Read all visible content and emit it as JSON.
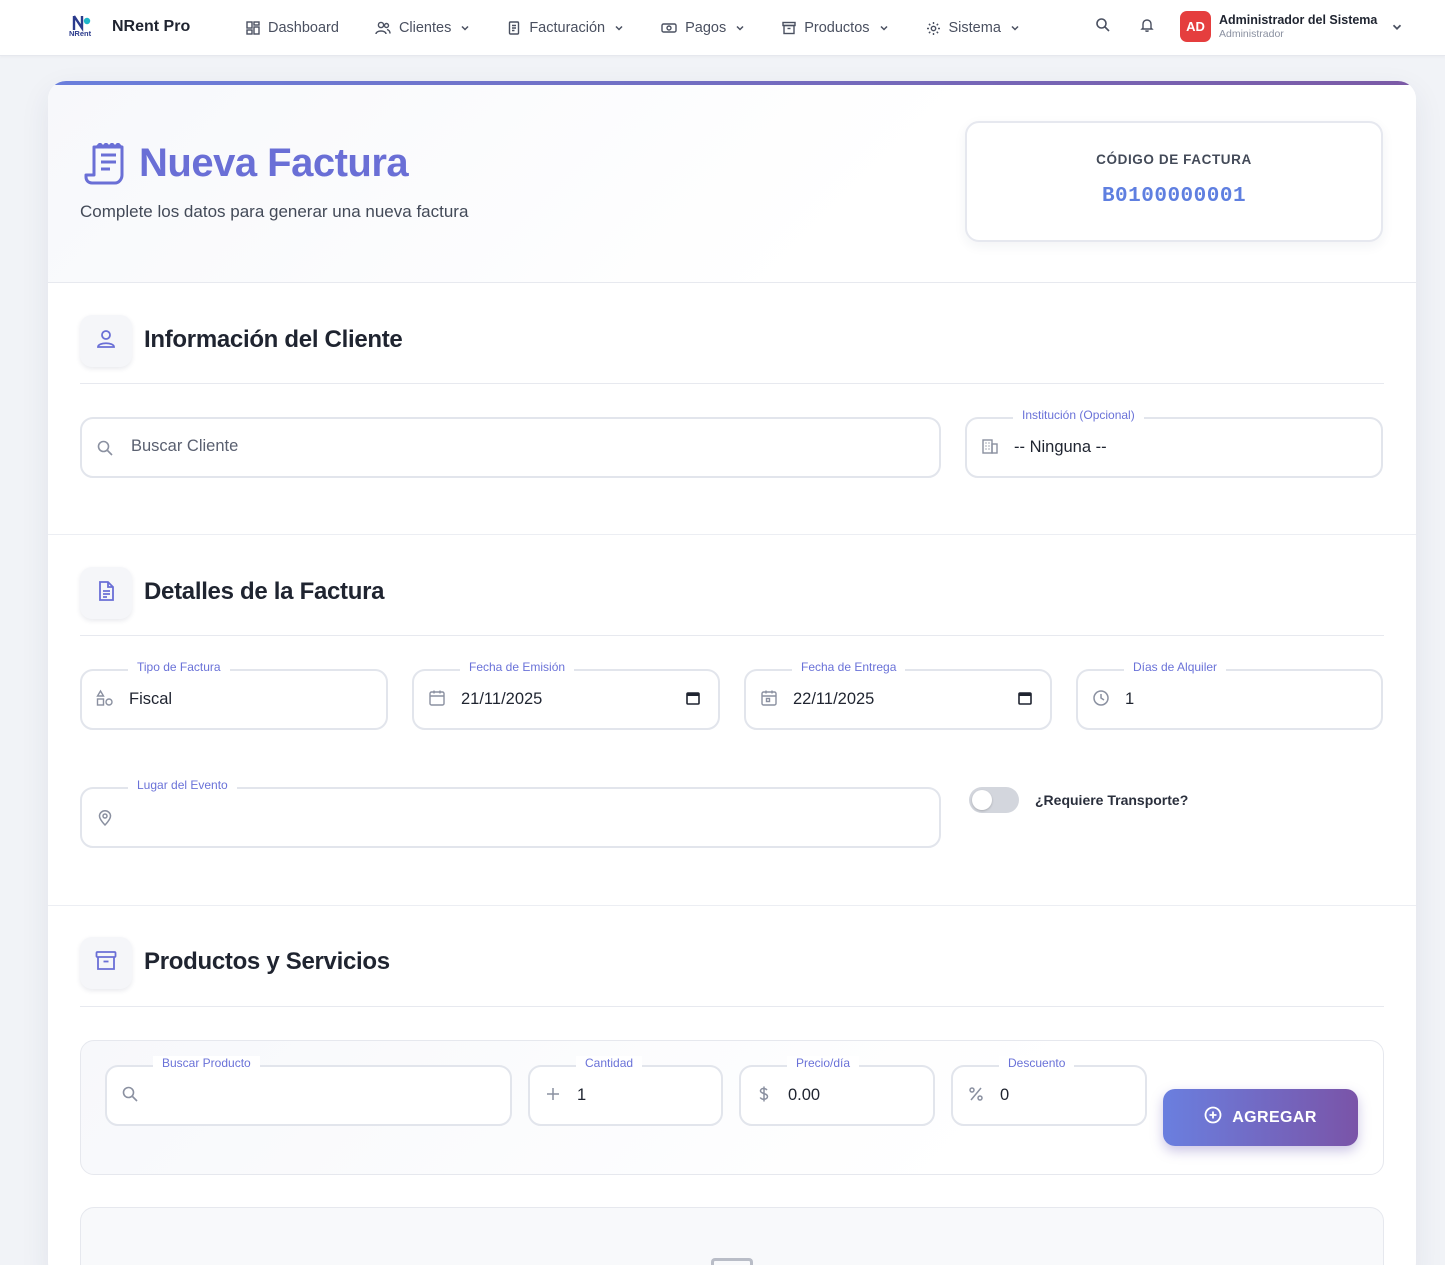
{
  "app": {
    "brand": "NRent Pro",
    "logo_text": "NRent"
  },
  "nav": {
    "items": [
      {
        "label": "Dashboard",
        "icon": "dashboard-icon",
        "has_menu": false
      },
      {
        "label": "Clientes",
        "icon": "users-icon",
        "has_menu": true
      },
      {
        "label": "Facturación",
        "icon": "receipt-icon",
        "has_menu": true
      },
      {
        "label": "Pagos",
        "icon": "money-icon",
        "has_menu": true
      },
      {
        "label": "Productos",
        "icon": "archive-icon",
        "has_menu": true
      },
      {
        "label": "Sistema",
        "icon": "gear-icon",
        "has_menu": true
      }
    ]
  },
  "user": {
    "initials": "AD",
    "name": "Administrador del Sistema",
    "role": "Administrador"
  },
  "page": {
    "title": "Nueva Factura",
    "subtitle": "Complete los datos para generar una nueva factura",
    "code_label": "CÓDIGO DE FACTURA",
    "code_value": "B0100000001"
  },
  "client_section": {
    "title": "Información del Cliente",
    "search_placeholder": "Buscar Cliente",
    "institution_label": "Institución (Opcional)",
    "institution_value": "-- Ninguna --"
  },
  "details_section": {
    "title": "Detalles de la Factura",
    "type_label": "Tipo de Factura",
    "type_value": "Fiscal",
    "issue_label": "Fecha de Emisión",
    "issue_value": "21/11/2025",
    "delivery_label": "Fecha de Entrega",
    "delivery_value": "22/11/2025",
    "days_label": "Días de Alquiler",
    "days_value": "1",
    "place_label": "Lugar del Evento",
    "place_value": "",
    "transport_label": "¿Requiere Transporte?",
    "transport_on": false
  },
  "products_section": {
    "title": "Productos y Servicios",
    "search_label": "Buscar Producto",
    "search_value": "",
    "qty_label": "Cantidad",
    "qty_value": "1",
    "price_label": "Precio/día",
    "price_value": "0.00",
    "discount_label": "Descuento",
    "discount_value": "0",
    "add_label": "AGREGAR"
  },
  "colors": {
    "accent": "#6a6fd6",
    "accent_gradient_end": "#7a54a8",
    "avatar": "#e53e3e"
  }
}
